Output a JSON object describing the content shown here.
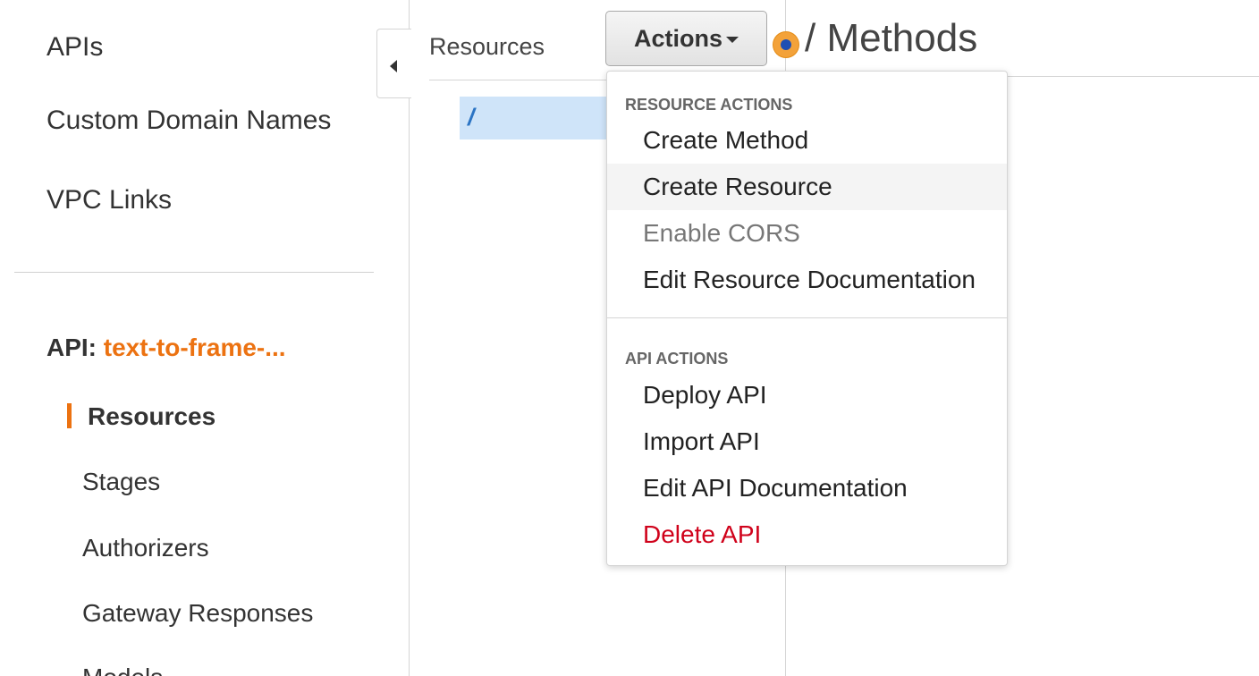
{
  "sidebar": {
    "nav": {
      "apis": "APIs",
      "custom_domain_names": "Custom Domain Names",
      "vpc_links": "VPC Links"
    },
    "api_label": "API:",
    "api_name": "text-to-frame-...",
    "items": {
      "resources": "Resources",
      "stages": "Stages",
      "authorizers": "Authorizers",
      "gateway_responses": "Gateway Responses",
      "models": "Models"
    }
  },
  "resources_panel": {
    "title": "Resources",
    "root_path": "/"
  },
  "actions_button": {
    "label": "Actions"
  },
  "methods_header": {
    "title": "/ Methods"
  },
  "actions_menu": {
    "resource_actions_header": "RESOURCE ACTIONS",
    "resource_actions": {
      "create_method": "Create Method",
      "create_resource": "Create Resource",
      "enable_cors": "Enable CORS",
      "edit_resource_documentation": "Edit Resource Documentation"
    },
    "api_actions_header": "API ACTIONS",
    "api_actions": {
      "deploy_api": "Deploy API",
      "import_api": "Import API",
      "edit_api_documentation": "Edit API Documentation",
      "delete_api": "Delete API"
    }
  },
  "colors": {
    "accent_orange": "#ec7211",
    "selection_blue": "#cfe4f9",
    "danger_red": "#d0021b"
  }
}
